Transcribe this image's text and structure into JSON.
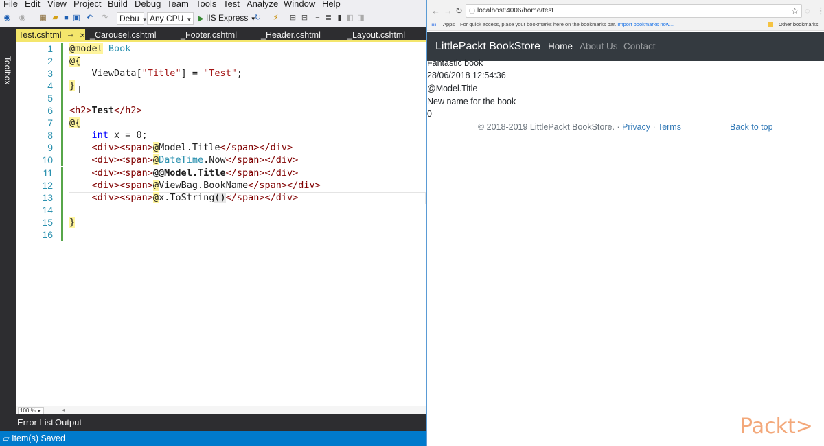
{
  "menu": [
    "File",
    "Edit",
    "View",
    "Project",
    "Build",
    "Debug",
    "Team",
    "Tools",
    "Test",
    "Analyze",
    "Window",
    "Help"
  ],
  "toolbar": {
    "config": "Debu",
    "platform": "Any CPU",
    "run_target": "IIS Express"
  },
  "toolbox_label": "Toolbox",
  "tabs": [
    {
      "label": "Test.cshtml",
      "active": true
    },
    {
      "label": "_Carousel.cshtml"
    },
    {
      "label": "_Footer.cshtml"
    },
    {
      "label": "_Header.cshtml"
    },
    {
      "label": "_Layout.cshtml"
    }
  ],
  "code_lines": [
    {
      "n": "1",
      "t": [
        [
          "razor",
          "@model"
        ],
        [
          "dl",
          " "
        ],
        [
          "ty",
          "Book"
        ]
      ]
    },
    {
      "n": "2",
      "t": [
        [
          "razor",
          "@{"
        ]
      ]
    },
    {
      "n": "3",
      "t": [
        [
          "dl",
          "    ViewData["
        ],
        [
          "str",
          "\"Title\""
        ],
        [
          "dl",
          "] = "
        ],
        [
          "str",
          "\"Test\""
        ],
        [
          "dl",
          ";"
        ]
      ]
    },
    {
      "n": "4",
      "t": [
        [
          "razor",
          "}"
        ]
      ]
    },
    {
      "n": "5",
      "t": []
    },
    {
      "n": "6",
      "t": [
        [
          "tag",
          "<h2>"
        ],
        [
          "bold",
          "Test"
        ],
        [
          "tag",
          "</h2>"
        ]
      ]
    },
    {
      "n": "7",
      "t": [
        [
          "razor",
          "@{"
        ]
      ]
    },
    {
      "n": "8",
      "t": [
        [
          "dl",
          "    "
        ],
        [
          "kw",
          "int"
        ],
        [
          "dl",
          " x = 0;"
        ]
      ]
    },
    {
      "n": "9",
      "t": [
        [
          "dl",
          "    "
        ],
        [
          "tag",
          "<div><span>"
        ],
        [
          "razor",
          "@"
        ],
        [
          "dl",
          "Model.Title"
        ],
        [
          "tag",
          "</span></div>"
        ]
      ]
    },
    {
      "n": "10",
      "t": [
        [
          "dl",
          "    "
        ],
        [
          "tag",
          "<div><span>"
        ],
        [
          "razor",
          "@"
        ],
        [
          "ty2",
          "DateTime"
        ],
        [
          "dl",
          ".Now"
        ],
        [
          "tag",
          "</span></div>"
        ]
      ]
    },
    {
      "n": "11",
      "t": [
        [
          "dl",
          "    "
        ],
        [
          "tag",
          "<div><span>"
        ],
        [
          "bold",
          "@@Model.Title"
        ],
        [
          "tag",
          "</span></div>"
        ]
      ]
    },
    {
      "n": "12",
      "t": [
        [
          "dl",
          "    "
        ],
        [
          "tag",
          "<div><span>"
        ],
        [
          "razor",
          "@"
        ],
        [
          "dl",
          "ViewBag.BookName"
        ],
        [
          "tag",
          "</span></div>"
        ]
      ]
    },
    {
      "n": "13",
      "t": [
        [
          "dl",
          "    "
        ],
        [
          "tag",
          "<div><span>"
        ],
        [
          "razor",
          "@"
        ],
        [
          "dl",
          "x.ToString"
        ],
        [
          "cb",
          "()"
        ],
        [
          "tag",
          "</span></div>"
        ]
      ]
    },
    {
      "n": "14",
      "t": []
    },
    {
      "n": "15",
      "t": [
        [
          "razor",
          "}"
        ]
      ]
    },
    {
      "n": "16",
      "t": []
    }
  ],
  "zoom": "100 %",
  "bottom_tabs": [
    "Error List",
    "Output"
  ],
  "status": "Item(s) Saved",
  "browser": {
    "url": "localhost:4006/home/test",
    "apps": "Apps",
    "bookmarks_hint": "For quick access, place your bookmarks here on the bookmarks bar.",
    "import_link": "Import bookmarks now...",
    "other_bookmarks": "Other bookmarks"
  },
  "site": {
    "brand": "LittlePackt BookStore",
    "nav": [
      "Home",
      "About Us",
      "Contact"
    ],
    "body_lines": [
      "Fantastic book",
      "28/06/2018 12:54:36",
      "@Model.Title",
      "New name for the book",
      "0"
    ],
    "footer_copyright": "© 2018-2019 LittlePackt BookStore. ·",
    "footer_privacy": "Privacy",
    "footer_sep": "·",
    "footer_terms": "Terms",
    "back_to_top": "Back to top"
  },
  "watermark": "Packt>"
}
